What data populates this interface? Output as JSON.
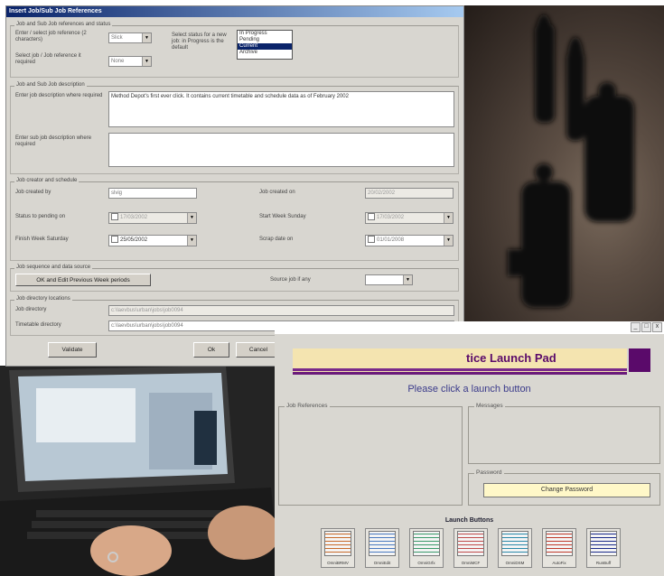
{
  "dialog": {
    "title": "Insert Job/Sub Job References",
    "sec_refs": "Job and Sub Job references and status",
    "lbl_job_ref": "Enter / select job reference (2 characters)",
    "job_ref_value": "Slick",
    "lbl_subjob_ref": "Select job / Job reference it required",
    "subjob_ref_value": "None",
    "lbl_status": "Select status for a new job: in Progress is the default",
    "status_options": [
      "In Progress",
      "Pending",
      "Current",
      "Archive"
    ],
    "status_selected": "Current",
    "sec_desc": "Job and Sub Job description",
    "lbl_job_desc": "Enter job description where required",
    "job_desc_value": "Method Depot's first ever click. It contains current timetable and schedule data as of February 2002",
    "lbl_subjob_desc": "Enter sub job description where required",
    "sec_creator": "Job creator and schedule",
    "lbl_created_by": "Job created by",
    "created_by_value": "slvig",
    "lbl_created_on": "Job created on",
    "created_on_value": "20/02/2002",
    "lbl_status_pending": "Status to pending on",
    "status_pending_value": "17/03/2002",
    "lbl_start_week": "Start Week Sunday",
    "start_week_value": "17/03/2002",
    "lbl_finish_week": "Finish Week Saturday",
    "finish_week_value": "25/05/2002",
    "lbl_scrap_date": "Scrap date on",
    "scrap_date_value": "01/01/2008",
    "sec_sequence": "Job sequence and data source",
    "ok_edit_label": "OK and Edit Previous Week periods",
    "lbl_source_job": "Source job if any",
    "sec_dirs": "Job directory locations",
    "lbl_job_dir": "Job directory",
    "job_dir_value": "c:\\laevbus\\urban\\jobs\\job0094",
    "lbl_timetable_dir": "Timetable directory",
    "timetable_dir_value": "c:\\laevbus\\urban\\jobs\\job0094",
    "validate_label": "Validate",
    "ok_label": "Ok",
    "cancel_label": "Cancel"
  },
  "launchpad": {
    "title": "tice Launch Pad",
    "window_controls": [
      "_",
      "□",
      "x"
    ],
    "prompt": "Please click a launch button",
    "job_references_label": "Job References",
    "messages_label": "Messages",
    "password_label": "Password",
    "change_password_label": "Change Password",
    "launch_buttons_label": "Launch Buttons",
    "buttons": [
      {
        "caption": "OmniBRMV",
        "icon": "timetable-grid-icon",
        "color": "#c86a2a"
      },
      {
        "caption": "OmniEdit",
        "icon": "chart-grid-icon",
        "color": "#4a7ac0"
      },
      {
        "caption": "OmniGrfx",
        "icon": "graph-grid-icon",
        "color": "#3a9a6a"
      },
      {
        "caption": "OmniMCF",
        "icon": "schedule-grid-icon",
        "color": "#c04a4a"
      },
      {
        "caption": "OmniDSM",
        "icon": "stacked-sheets-icon",
        "color": "#2a8aaa"
      },
      {
        "caption": "AutoFix",
        "icon": "figure-icon",
        "color": "#c03a2a"
      },
      {
        "caption": "RunBuff",
        "icon": "bus-badge-icon",
        "color": "#1a2a8a"
      }
    ]
  }
}
